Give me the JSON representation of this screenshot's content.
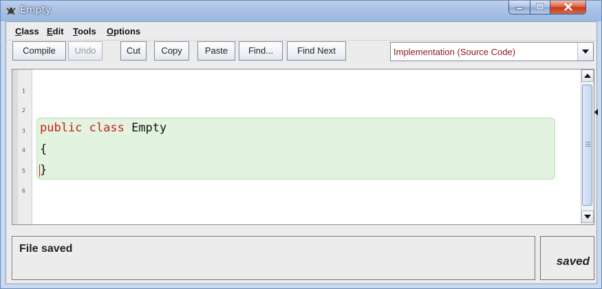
{
  "window": {
    "title": "Empty",
    "controls": {
      "minimize": "minimize",
      "maximize": "maximize",
      "close": "close"
    }
  },
  "menu": {
    "items": [
      {
        "mnemonic": "C",
        "rest": "lass"
      },
      {
        "mnemonic": "E",
        "rest": "dit"
      },
      {
        "mnemonic": "T",
        "rest": "ools"
      },
      {
        "mnemonic": "O",
        "rest": "ptions"
      }
    ]
  },
  "toolbar": {
    "compile": "Compile",
    "undo": "Undo",
    "cut": "Cut",
    "copy": "Copy",
    "paste": "Paste",
    "find": "Find...",
    "find_next": "Find Next",
    "view_select": "Implementation (Source Code)"
  },
  "editor": {
    "line_numbers": [
      "1",
      "2",
      "3",
      "4",
      "5",
      "6"
    ],
    "lines": [
      {
        "keyword": "public class",
        "text": " Empty"
      },
      {
        "keyword": "",
        "text": "{"
      },
      {
        "keyword": "",
        "text": "}"
      }
    ]
  },
  "status": {
    "message": "File saved",
    "state": "saved"
  },
  "colors": {
    "keyword": "#cc1b1b",
    "scope_background": "#e2f4df",
    "selector_text": "#8b1a1a"
  },
  "icons": [
    "app-icon",
    "minimize-icon",
    "maximize-icon",
    "close-icon",
    "dropdown-arrow-icon",
    "scroll-up-icon",
    "scroll-down-icon",
    "scroll-grip-icon",
    "side-arrow-icon"
  ]
}
